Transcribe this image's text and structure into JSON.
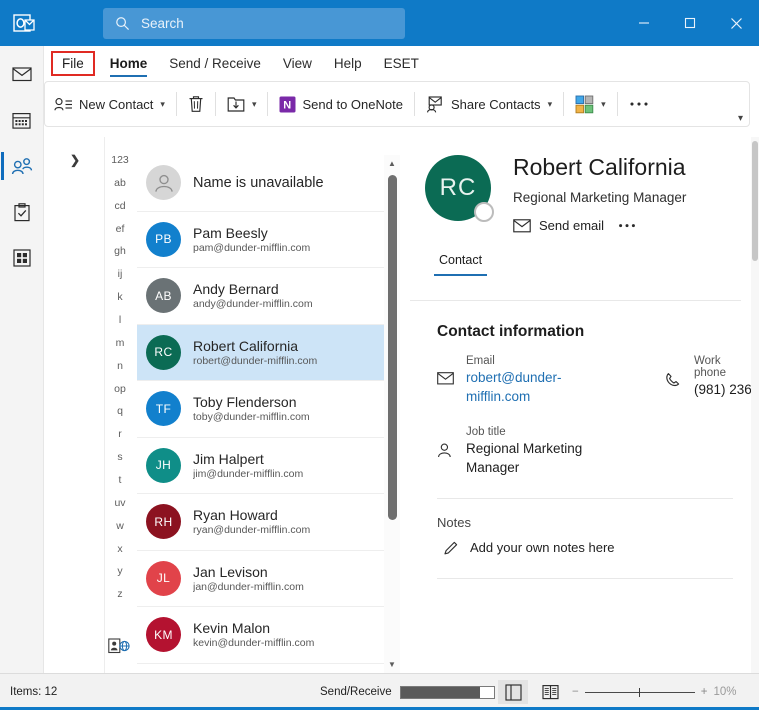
{
  "titlebar": {
    "logo_icon": "outlook-logo",
    "search_placeholder": "Search",
    "search_value": "",
    "search_icon": "search-icon",
    "minimize_label": "Minimize",
    "maximize_label": "Maximize",
    "close_label": "Close"
  },
  "tabs": {
    "mail_icon": "envelope-icon",
    "items": [
      {
        "label": "File",
        "state": "highlighted"
      },
      {
        "label": "Home",
        "state": "active"
      },
      {
        "label": "Send / Receive",
        "state": "normal"
      },
      {
        "label": "View",
        "state": "normal"
      },
      {
        "label": "Help",
        "state": "normal"
      },
      {
        "label": "ESET",
        "state": "normal"
      }
    ]
  },
  "ribbon": {
    "new_contact": "New Contact",
    "delete_icon": "trash-icon",
    "move_icon": "move-to-folder-icon",
    "onenote_label": "Send to OneNote",
    "onenote_icon": "onenote-icon",
    "share_contacts": "Share Contacts",
    "share_icon": "share-contacts-icon",
    "categorize_icon": "categorize-grid-icon",
    "more_icon": "more-ellipsis-icon",
    "collapse_icon": "chevron-down-icon"
  },
  "navrail": {
    "items": [
      {
        "name": "mail",
        "icon": "envelope-icon",
        "selected": false
      },
      {
        "name": "calendar",
        "icon": "calendar-icon",
        "selected": false
      },
      {
        "name": "people",
        "icon": "people-icon",
        "selected": true
      },
      {
        "name": "tasks",
        "icon": "clipboard-check-icon",
        "selected": false
      },
      {
        "name": "apps",
        "icon": "grid-apps-icon",
        "selected": false
      }
    ]
  },
  "folderpane": {
    "expand_icon": "chevron-right-icon"
  },
  "alpha_index": {
    "letters": [
      "123",
      "ab",
      "cd",
      "ef",
      "gh",
      "ij",
      "k",
      "l",
      "m",
      "n",
      "op",
      "q",
      "r",
      "s",
      "t",
      "uv",
      "w",
      "x",
      "y",
      "z"
    ],
    "contacts_icon": "address-book-icon"
  },
  "contact_list": {
    "scroll_up_icon": "caret-up-icon",
    "scroll_down_icon": "caret-down-icon",
    "rows": [
      {
        "initials": "",
        "name": "Name is unavailable",
        "email": "",
        "color": "#d6d6d6",
        "selected": false,
        "placeholder": true
      },
      {
        "initials": "PB",
        "name": "Pam Beesly",
        "email": "pam@dunder-mifflin.com",
        "color": "#1280cd",
        "selected": false,
        "placeholder": false
      },
      {
        "initials": "AB",
        "name": "Andy Bernard",
        "email": "andy@dunder-mifflin.com",
        "color": "#6a7275",
        "selected": false,
        "placeholder": false
      },
      {
        "initials": "RC",
        "name": "Robert California",
        "email": "robert@dunder-mifflin.com",
        "color": "#0b6b54",
        "selected": true,
        "placeholder": false
      },
      {
        "initials": "TF",
        "name": "Toby Flenderson",
        "email": "toby@dunder-mifflin.com",
        "color": "#1280cd",
        "selected": false,
        "placeholder": false
      },
      {
        "initials": "JH",
        "name": "Jim Halpert",
        "email": "jim@dunder-mifflin.com",
        "color": "#0f8e88",
        "selected": false,
        "placeholder": false
      },
      {
        "initials": "RH",
        "name": "Ryan Howard",
        "email": "ryan@dunder-mifflin.com",
        "color": "#8c1220",
        "selected": false,
        "placeholder": false
      },
      {
        "initials": "JL",
        "name": "Jan Levison",
        "email": "jan@dunder-mifflin.com",
        "color": "#e1434a",
        "selected": false,
        "placeholder": false
      },
      {
        "initials": "KM",
        "name": "Kevin Malon",
        "email": "kevin@dunder-mifflin.com",
        "color": "#b41230",
        "selected": false,
        "placeholder": false
      }
    ]
  },
  "detail": {
    "avatar_initials": "RC",
    "avatar_color": "#0b6b54",
    "presence_icon": "presence-offline-icon",
    "name": "Robert California",
    "job_title_header": "Regional Marketing Manager",
    "send_email_label": "Send email",
    "send_email_icon": "envelope-icon",
    "more_icon": "more-ellipsis-icon",
    "tab_contact": "Contact",
    "section_title": "Contact information",
    "fields": {
      "email_label": "Email",
      "email_value": "robert@dunder-mifflin.com",
      "email_icon": "envelope-icon",
      "jobtitle_label": "Job title",
      "jobtitle_value": "Regional Marketing Manager",
      "jobtitle_icon": "person-icon",
      "workphone_label": "Work phone",
      "workphone_value": "(981) 236",
      "workphone_icon": "phone-icon"
    },
    "notes_title": "Notes",
    "notes_placeholder": "Add your own notes here",
    "notes_icon": "pencil-icon"
  },
  "status": {
    "items_count": "Items: 12",
    "send_receive_label": "Send/Receive",
    "send_receive_progress": 85,
    "view_normal_icon": "reading-pane-icon",
    "view_reading_icon": "book-view-icon",
    "zoom_out_icon": "minus-icon",
    "zoom_in_icon": "plus-icon",
    "zoom_level": "10%"
  },
  "colors": {
    "accent_blue": "#0f7ac7",
    "highlight_red": "#e02a23",
    "selection_blue": "#cde4f7",
    "tab_underline": "#1f6fb2"
  }
}
